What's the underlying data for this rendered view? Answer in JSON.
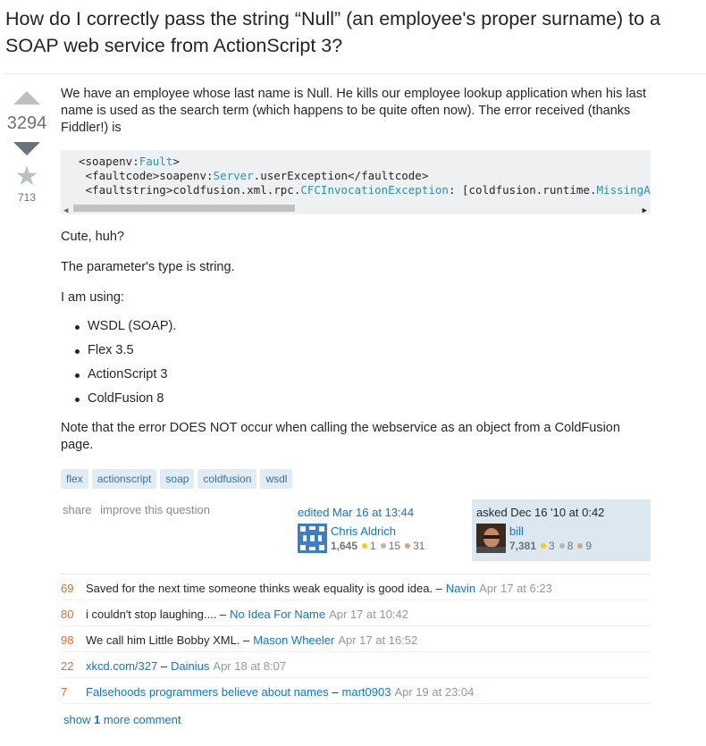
{
  "question": {
    "title": "How do I correctly pass the string “Null” (an employee's proper surname) to a SOAP web service from ActionScript 3?",
    "vote_count": "3294",
    "favorite_count": "713",
    "intro": "We have an employee whose last name is Null. He kills our employee lookup application when his last name is used as the search term (which happens to be quite often now). The error received (thanks Fiddler!) is",
    "code_lines": [
      {
        "pre": "<soapenv:",
        "typ": "Fault",
        "post": ">"
      },
      {
        "pre": " <faultcode>soapenv:",
        "typ": "Server",
        "post": ".userException</faultcode>"
      },
      {
        "pre": " <faultstring>coldfusion.xml.rpc.",
        "typ": "CFCInvocationException",
        "post": ": [coldfusion.runtime.",
        "typ2": "MissingArgumentException"
      }
    ],
    "p_cute": "Cute, huh?",
    "p_type": "The parameter's type is string.",
    "p_using": "I am using:",
    "using_list": [
      "WSDL (SOAP).",
      "Flex 3.5",
      "ActionScript 3",
      "ColdFusion 8"
    ],
    "note": "Note that the error DOES NOT occur when calling the webservice as an object from a ColdFusion page.",
    "tags": [
      "flex",
      "actionscript",
      "soap",
      "coldfusion",
      "wsdl"
    ],
    "actions": {
      "share": "share",
      "improve": "improve this question"
    },
    "edited": {
      "action": "edited Mar 16 at 13:44",
      "user": "Chris Aldrich",
      "rep": "1,645",
      "gold": "1",
      "silver": "15",
      "bronze": "31"
    },
    "asked": {
      "action": "asked Dec 16 '10 at 0:42",
      "user": "bill",
      "rep": "7,381",
      "gold": "3",
      "silver": "8",
      "bronze": "9"
    }
  },
  "comments": [
    {
      "score": "69",
      "text": "Saved for the next time someone thinks weak equality is good idea. –",
      "user": "Navin",
      "date": "Apr 17 at 6:23"
    },
    {
      "score": "80",
      "text": "i couldn't stop laughing.... –",
      "user": "No Idea For Name",
      "date": "Apr 17 at 10:42"
    },
    {
      "score": "98",
      "text": "We call him Little Bobby XML. –",
      "user": "Mason Wheeler",
      "date": "Apr 17 at 16:52"
    },
    {
      "score": "22",
      "link": "xkcd.com/327",
      "text": " –",
      "user": "Dainius",
      "date": "Apr 18 at 8:07"
    },
    {
      "score": "7",
      "link": "Falsehoods programmers believe about names",
      "text": " –",
      "user": "mart0903",
      "date": "Apr 19 at 23:04"
    }
  ],
  "show_more": {
    "prefix": "show ",
    "count": "1",
    "suffix": " more comment"
  },
  "colors": {
    "accent": "#0c77cf",
    "tag_bg": "#e1ecf4",
    "owner_bg": "#dce8f1",
    "comment_score": "#e06c2e"
  },
  "icons": [
    "vote-up-icon",
    "vote-down-icon",
    "favorite-star-icon",
    "scroll-left-icon",
    "scroll-right-icon"
  ]
}
